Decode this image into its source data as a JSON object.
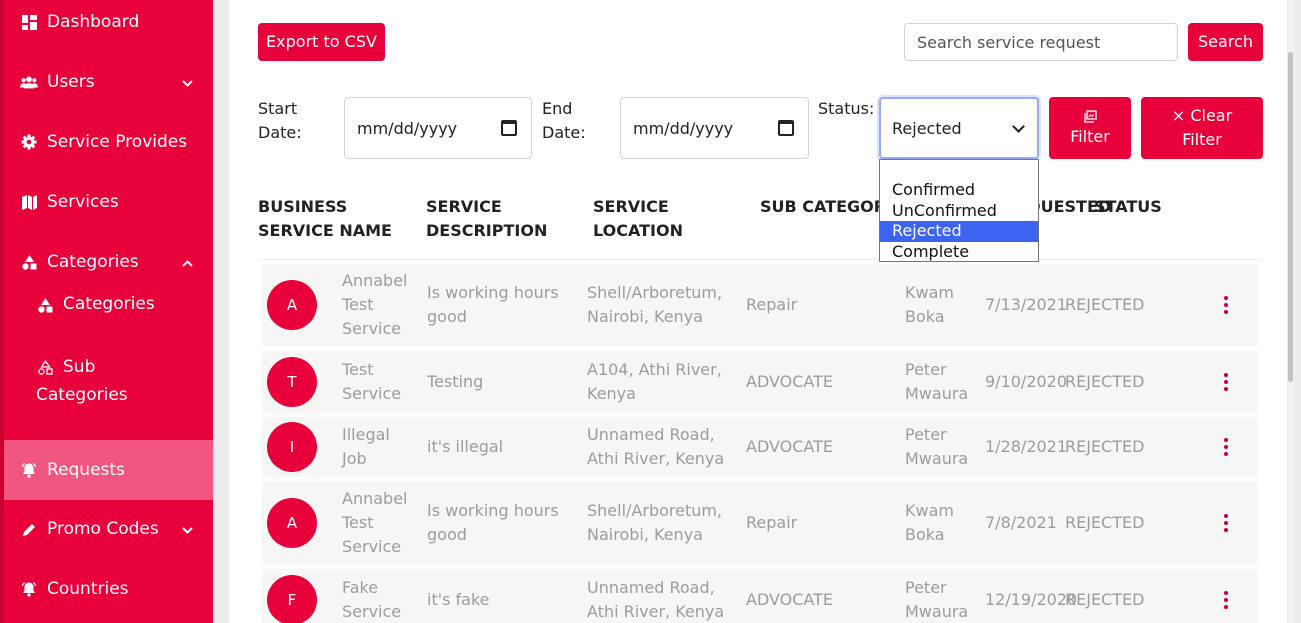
{
  "sidebar": {
    "items": [
      {
        "label": "Dashboard",
        "icon": "dashboard-icon"
      },
      {
        "label": "Users",
        "icon": "users-icon",
        "chevron": "down"
      },
      {
        "label": "Service Provides",
        "icon": "gear-icon"
      },
      {
        "label": "Services",
        "icon": "map-icon"
      },
      {
        "label": "Categories",
        "icon": "shapes-icon",
        "chevron": "up"
      },
      {
        "label": "Requests",
        "icon": "bell-icon",
        "active": true
      },
      {
        "label": "Promo Codes",
        "icon": "pencil-icon",
        "chevron": "down"
      },
      {
        "label": "Countries",
        "icon": "bell-icon"
      }
    ],
    "sub_items": [
      {
        "label": "Categories",
        "icon": "shapes-icon"
      },
      {
        "label": "Sub Categories",
        "line1": "Sub",
        "line2": "Categories",
        "icon": "shapes-outline-icon"
      }
    ]
  },
  "toolbar": {
    "export_label": "Export to CSV",
    "search_placeholder": "Search service request",
    "search_label": "Search"
  },
  "filters": {
    "start_date_label_1": "Start",
    "start_date_label_2": "Date:",
    "start_date_value": "mm/dd/yyyy",
    "end_date_label_1": "End",
    "end_date_label_2": "Date:",
    "end_date_value": "mm/dd/yyyy",
    "status_label": "Status:",
    "status_value": "Rejected",
    "status_options": [
      "Confirmed",
      "UnConfirmed",
      "Rejected",
      "Complete"
    ],
    "filter_label": "Filter",
    "clear_label_1": "× Clear",
    "clear_label_2": "Filter"
  },
  "table": {
    "headers": {
      "business_1": "BUSINESS",
      "business_2": "SERVICE NAME",
      "desc_1": "SERVICE",
      "desc_2": "DESCRIPTION",
      "loc_1": "SERVICE",
      "loc_2": "LOCATION",
      "subcat": "SUB CATEGORY",
      "requested": "QUESTED",
      "status": "STATUS"
    },
    "rows": [
      {
        "initial": "A",
        "name": [
          "Annabel",
          "Test",
          "Service"
        ],
        "desc": [
          "Is working hours",
          "good"
        ],
        "loc": [
          "Shell/Arboretum,",
          "Nairobi, Kenya"
        ],
        "subcat": "Repair",
        "requester": [
          "Kwam",
          "Boka"
        ],
        "date": "7/13/2021",
        "status": "REJECTED"
      },
      {
        "initial": "T",
        "name": [
          "Test",
          "Service"
        ],
        "desc": [
          "Testing"
        ],
        "loc": [
          "A104, Athi River,",
          "Kenya"
        ],
        "subcat": "ADVOCATE",
        "requester": [
          "Peter",
          "Mwaura"
        ],
        "date": "9/10/2020",
        "status": "REJECTED"
      },
      {
        "initial": "I",
        "name": [
          "Illegal",
          "Job"
        ],
        "desc": [
          "it's illegal"
        ],
        "loc": [
          "Unnamed Road,",
          "Athi River, Kenya"
        ],
        "subcat": "ADVOCATE",
        "requester": [
          "Peter",
          "Mwaura"
        ],
        "date": "1/28/2021",
        "status": "REJECTED"
      },
      {
        "initial": "A",
        "name": [
          "Annabel",
          "Test",
          "Service"
        ],
        "desc": [
          "Is working hours",
          "good"
        ],
        "loc": [
          "Shell/Arboretum,",
          "Nairobi, Kenya"
        ],
        "subcat": "Repair",
        "requester": [
          "Kwam",
          "Boka"
        ],
        "date": "7/8/2021",
        "status": "REJECTED"
      },
      {
        "initial": "F",
        "name": [
          "Fake",
          "Service"
        ],
        "desc": [
          "it's fake"
        ],
        "loc": [
          "Unnamed Road,",
          "Athi River, Kenya"
        ],
        "subcat": "ADVOCATE",
        "requester": [
          "Peter",
          "Mwaura"
        ],
        "date": "12/19/2020",
        "status": "REJECTED"
      }
    ]
  },
  "colors": {
    "accent": "#e8003a",
    "active_nav": "#f05680",
    "selected_option": "#3c64f0"
  }
}
